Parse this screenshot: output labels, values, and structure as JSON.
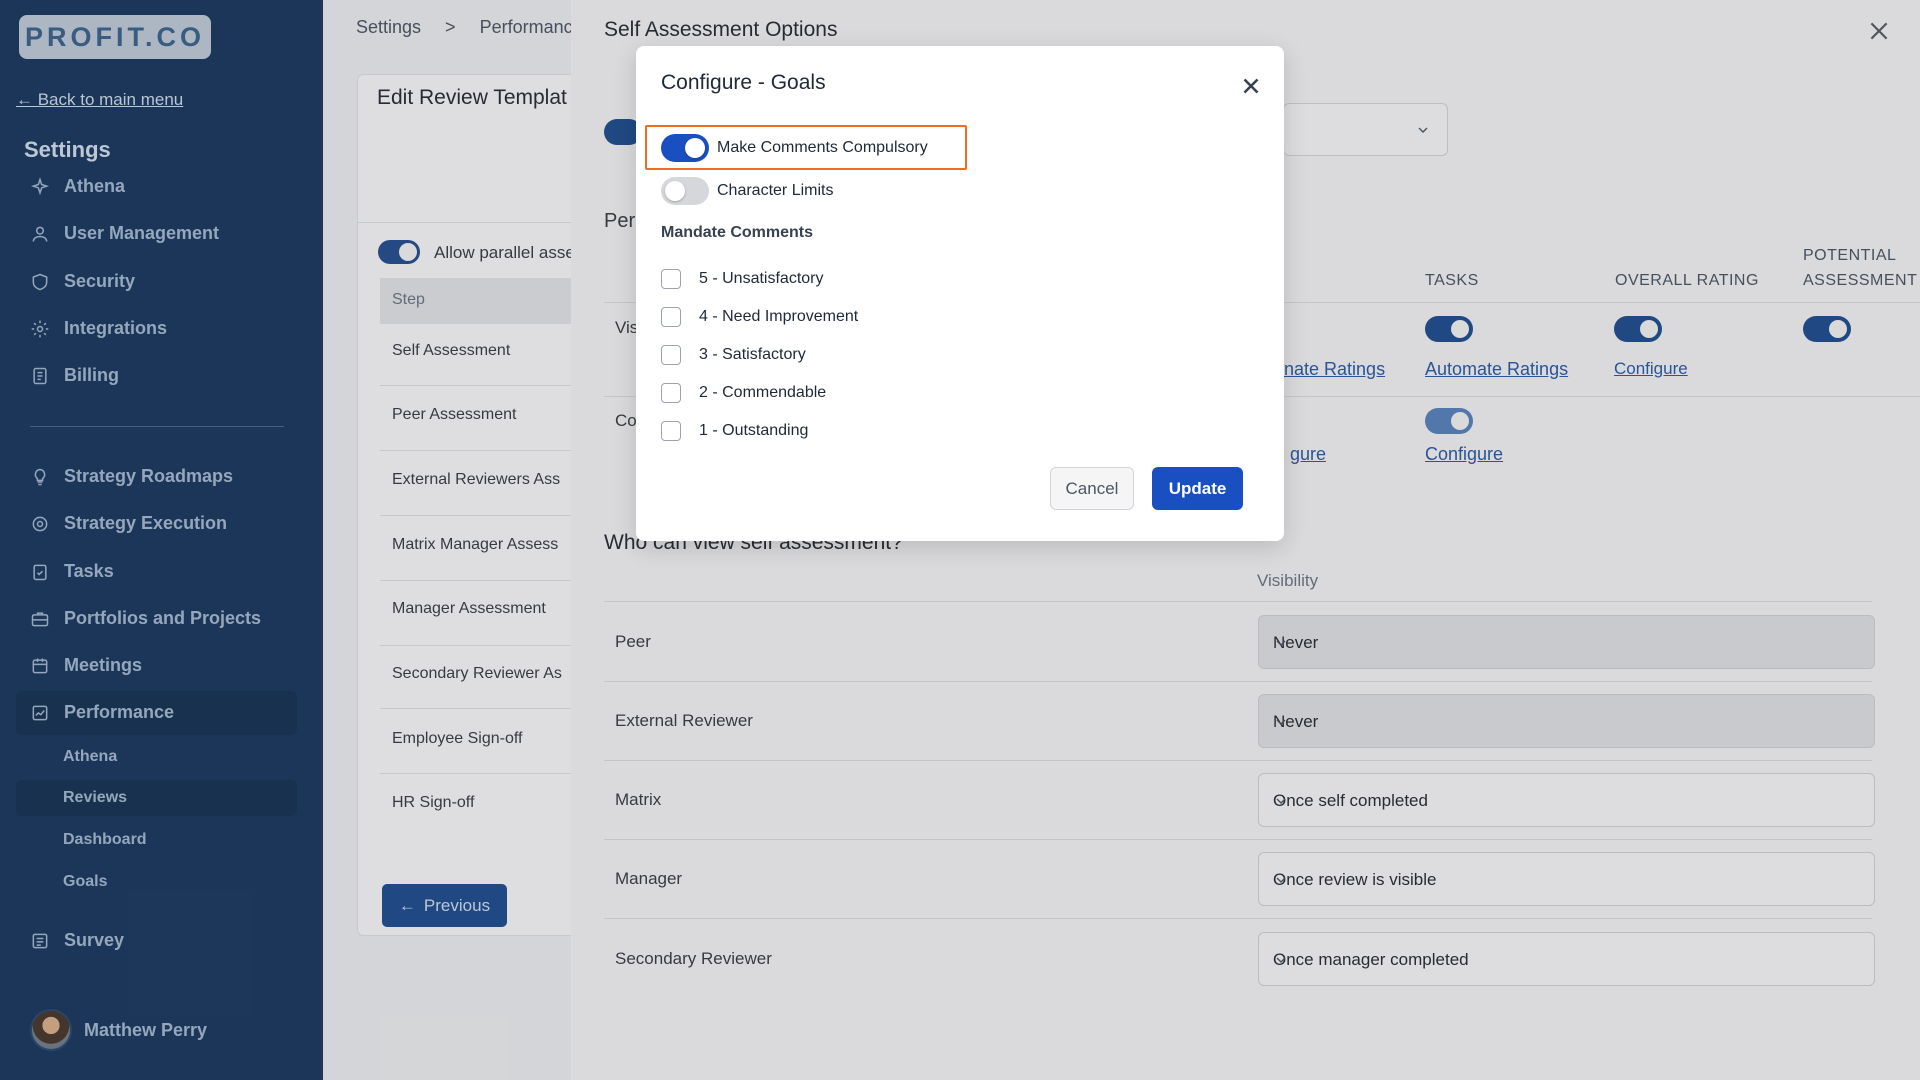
{
  "brand": {
    "logo_text": "PROFIT.CO"
  },
  "sidebar": {
    "back_link": "← Back to main menu",
    "heading": "Settings",
    "settings_items": [
      {
        "label": "Athena",
        "icon": "sparkle-icon"
      },
      {
        "label": "User Management",
        "icon": "user-icon"
      },
      {
        "label": "Security",
        "icon": "shield-icon"
      },
      {
        "label": "Integrations",
        "icon": "gear-icon"
      },
      {
        "label": "Billing",
        "icon": "receipt-icon"
      }
    ],
    "app_items": [
      {
        "label": "Strategy Roadmaps",
        "icon": "lightbulb-icon"
      },
      {
        "label": "Strategy Execution",
        "icon": "target-icon"
      },
      {
        "label": "Tasks",
        "icon": "clipboard-check-icon"
      },
      {
        "label": "Portfolios and Projects",
        "icon": "briefcase-icon"
      },
      {
        "label": "Meetings",
        "icon": "calendar-icon"
      },
      {
        "label": "Performance",
        "icon": "chart-line-icon"
      }
    ],
    "performance_sub": [
      "Athena",
      "Reviews",
      "Dashboard",
      "Goals"
    ],
    "survey": {
      "label": "Survey",
      "icon": "survey-icon"
    },
    "user_name": "Matthew Perry"
  },
  "page": {
    "breadcrumb": [
      "Settings",
      ">",
      "Performanc"
    ],
    "card_title": "Edit Review Templat",
    "allow_parallel": "Allow parallel asse",
    "step_header": "Step",
    "steps": [
      "Self Assessment",
      "Peer Assessment",
      "External Reviewers Ass",
      "Matrix Manager Assess",
      "Manager Assessment",
      "Secondary Reviewer As",
      "Employee Sign-off",
      "HR Sign-off"
    ],
    "previous_btn": "Previous"
  },
  "panel": {
    "title": "Self Assessment Options",
    "peek_per": "Per",
    "row_vis": "Vis",
    "row_co": "Co",
    "col_tasks": "TASKS",
    "col_overall": "OVERALL RATING",
    "col_potential_1": "POTENTIAL",
    "col_potential_2": "ASSESSMENT",
    "link_automate_partial": "nate Ratings",
    "link_automate": "Automate Ratings",
    "link_configure": "Configure",
    "link_configure_partial": "gure",
    "who_title": "Who can view self assessment?",
    "visibility_header": "Visibility",
    "visibility_rows": [
      {
        "label": "Peer",
        "value": "Never"
      },
      {
        "label": "External Reviewer",
        "value": "Never"
      },
      {
        "label": "Matrix",
        "value": "Once self completed"
      },
      {
        "label": "Manager",
        "value": "Once review is visible"
      },
      {
        "label": "Secondary Reviewer",
        "value": "Once manager completed"
      }
    ]
  },
  "modal": {
    "title": "Configure - Goals",
    "make_comments": {
      "label": "Make Comments Compulsory",
      "on": true
    },
    "character_limits": {
      "label": "Character Limits",
      "on": false
    },
    "mandate_heading": "Mandate Comments",
    "ratings": [
      "5 - Unsatisfactory",
      "4 - Need Improvement",
      "3 - Satisfactory",
      "2 - Commendable",
      "1 - Outstanding"
    ],
    "cancel": "Cancel",
    "update": "Update"
  },
  "colors": {
    "sidebar_bg": "#1e3a5f",
    "primary": "#1a4fc2",
    "focus_outline": "#ee6d22"
  }
}
